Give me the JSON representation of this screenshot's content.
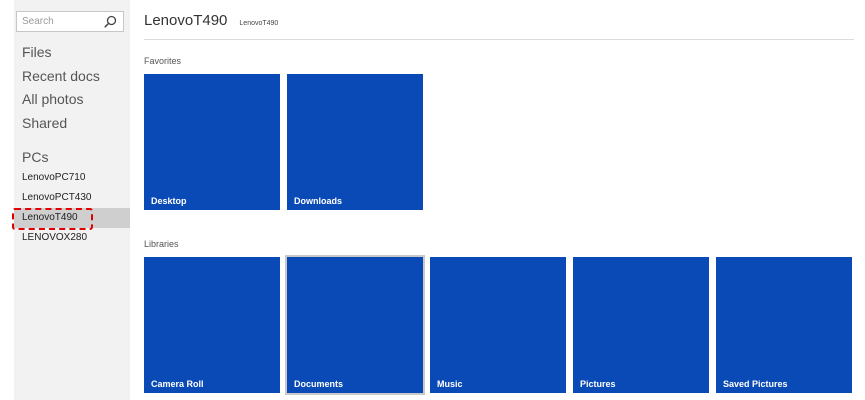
{
  "sidebar": {
    "search": {
      "placeholder": "Search",
      "value": ""
    },
    "nav": [
      {
        "label": "Files"
      },
      {
        "label": "Recent docs"
      },
      {
        "label": "All photos"
      },
      {
        "label": "Shared"
      }
    ],
    "pcs_heading": "PCs",
    "pcs": [
      {
        "label": "LenovoPC710"
      },
      {
        "label": "LenovoPCT430"
      },
      {
        "label": "LenovoT490",
        "selected": true
      },
      {
        "label": "LENOVOX280"
      }
    ]
  },
  "header": {
    "title": "LenovoT490",
    "subtitle": "LenovoT490"
  },
  "favorites": {
    "label": "Favorites",
    "tiles": [
      {
        "label": "Desktop"
      },
      {
        "label": "Downloads"
      }
    ]
  },
  "libraries": {
    "label": "Libraries",
    "tiles": [
      {
        "label": "Camera Roll"
      },
      {
        "label": "Documents",
        "focused": true
      },
      {
        "label": "Music"
      },
      {
        "label": "Pictures"
      },
      {
        "label": "Saved Pictures"
      }
    ]
  },
  "colors": {
    "tile": "#0a4ab6",
    "sidebar_bg": "#f2f2f2",
    "selected_bg": "#cfcfcf",
    "highlight_outline": "#e00000"
  }
}
